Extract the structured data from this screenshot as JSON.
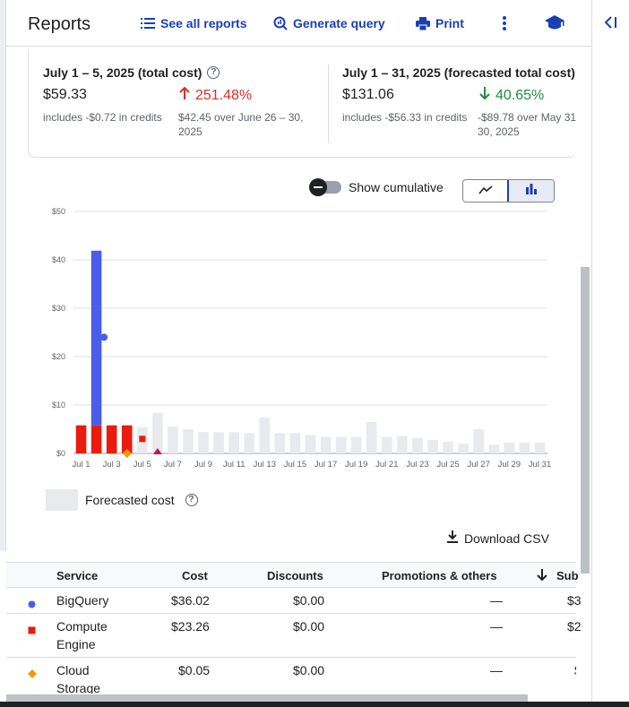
{
  "header": {
    "title": "Reports",
    "see_all": "See all reports",
    "generate_query": "Generate query",
    "print": "Print"
  },
  "summary": {
    "left": {
      "label": "July 1 – 5, 2025 (total cost)",
      "value": "$59.33",
      "credits": "includes -$0.72 in credits",
      "change": "251.48%",
      "comparison_line1": "$42.45 over June 26 – 30,",
      "comparison_line2": "2025"
    },
    "right": {
      "label": "July 1 – 31, 2025 (forecasted total cost)",
      "value": "$131.06",
      "credits": "includes -$56.33 in credits",
      "change": "40.65%",
      "comparison_line1": "-$89.78 over May 31 –",
      "comparison_line2": "30, 2025"
    }
  },
  "controls": {
    "show_cumulative": "Show cumulative",
    "cumulative_on": false,
    "view_mode": "bar"
  },
  "chart_data": {
    "type": "bar",
    "categories": [
      "Jul 1",
      "Jul 2",
      "Jul 3",
      "Jul 4",
      "Jul 5",
      "Jul 6",
      "Jul 7",
      "Jul 8",
      "Jul 9",
      "Jul 10",
      "Jul 11",
      "Jul 12",
      "Jul 13",
      "Jul 14",
      "Jul 15",
      "Jul 16",
      "Jul 17",
      "Jul 18",
      "Jul 19",
      "Jul 20",
      "Jul 21",
      "Jul 22",
      "Jul 23",
      "Jul 24",
      "Jul 25",
      "Jul 26",
      "Jul 27",
      "Jul 28",
      "Jul 29",
      "Jul 30",
      "Jul 31"
    ],
    "tick_labels": [
      "Jul 1",
      "Jul 3",
      "Jul 5",
      "Jul 7",
      "Jul 9",
      "Jul 11",
      "Jul 13",
      "Jul 15",
      "Jul 17",
      "Jul 19",
      "Jul 21",
      "Jul 23",
      "Jul 25",
      "Jul 27",
      "Jul 29",
      "Jul 31"
    ],
    "ylim": [
      0,
      50
    ],
    "yticks": [
      "$0",
      "$10",
      "$20",
      "$30",
      "$40",
      "$50"
    ],
    "series": [
      {
        "name": "BigQuery",
        "color": "#4a5de8",
        "values": [
          0,
          36.1,
          0,
          0,
          0,
          null,
          null,
          null,
          null,
          null,
          null,
          null,
          null,
          null,
          null,
          null,
          null,
          null,
          null,
          null,
          null,
          null,
          null,
          null,
          null,
          null,
          null,
          null,
          null,
          null,
          null
        ]
      },
      {
        "name": "Compute Engine",
        "color": "#ea1c0d",
        "values": [
          5.8,
          5.8,
          5.8,
          5.8,
          0,
          null,
          null,
          null,
          null,
          null,
          null,
          null,
          null,
          null,
          null,
          null,
          null,
          null,
          null,
          null,
          null,
          null,
          null,
          null,
          null,
          null,
          null,
          null,
          null,
          null,
          null
        ]
      },
      {
        "name": "Forecasted cost",
        "color": "#e8eaed",
        "values": [
          null,
          null,
          null,
          null,
          5.4,
          8.4,
          5.6,
          5.0,
          4.4,
          4.4,
          4.4,
          4.2,
          7.4,
          4.2,
          4.2,
          3.8,
          3.4,
          3.4,
          3.4,
          6.5,
          3.4,
          3.6,
          3.2,
          2.8,
          2.4,
          2.0,
          5.0,
          1.8,
          2.2,
          2.2,
          2.3
        ]
      }
    ],
    "markers": [
      {
        "series": "BigQuery",
        "day": 2.5,
        "value": 24,
        "shape": "circle",
        "color": "#4a5de8"
      },
      {
        "series": "Compute Engine",
        "day": 5,
        "value": 3,
        "shape": "square",
        "color": "#ea1c0d"
      },
      {
        "series": "Cloud Storage",
        "day": 4,
        "value": 0,
        "shape": "diamond",
        "color": "#f29900"
      },
      {
        "series": "Other",
        "day": 6,
        "value": 0,
        "shape": "triangle",
        "color": "#c2185b"
      }
    ]
  },
  "legend": {
    "forecast_label": "Forecasted cost"
  },
  "download": {
    "label": "Download CSV"
  },
  "table": {
    "headers": [
      "Service",
      "Cost",
      "Discounts",
      "Promotions & others",
      "Sub"
    ],
    "rows": [
      {
        "service": "BigQuery",
        "service_line2": "",
        "cost": "$36.02",
        "discounts": "$0.00",
        "promotions": "—",
        "sub": "$3",
        "marker": "circle",
        "color": "#4a5de8"
      },
      {
        "service": "Compute",
        "service_line2": "Engine",
        "cost": "$23.26",
        "discounts": "$0.00",
        "promotions": "—",
        "sub": "$2",
        "marker": "square",
        "color": "#ea1c0d"
      },
      {
        "service": "Cloud",
        "service_line2": "Storage",
        "cost": "$0.05",
        "discounts": "$0.00",
        "promotions": "—",
        "sub": "$",
        "marker": "diamond",
        "color": "#f29900"
      }
    ]
  }
}
